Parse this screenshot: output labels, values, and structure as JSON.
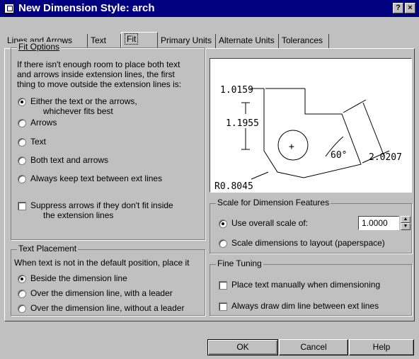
{
  "window": {
    "title": "New Dimension Style: arch",
    "help_btn": "?",
    "close_btn": "×"
  },
  "tabs": [
    {
      "label": "Lines and Arrows"
    },
    {
      "label": "Text"
    },
    {
      "label": "Fit",
      "active": true
    },
    {
      "label": "Primary Units"
    },
    {
      "label": "Alternate Units"
    },
    {
      "label": "Tolerances"
    }
  ],
  "fit_options": {
    "legend": "Fit Options",
    "description": [
      "If there isn't enough room to place both text",
      "and arrows inside extension lines, the first",
      "thing to move outside the extension lines is:"
    ],
    "radios": [
      {
        "label": "Either the text or the arrows,",
        "label2": "whichever fits best",
        "checked": true
      },
      {
        "label": "Arrows",
        "checked": false
      },
      {
        "label": "Text",
        "checked": false
      },
      {
        "label": "Both text and arrows",
        "checked": false
      },
      {
        "label": "Always keep text between ext lines",
        "checked": false
      }
    ],
    "suppress": {
      "label": "Suppress arrows if they don't fit inside",
      "label2": "the extension lines",
      "checked": false
    }
  },
  "text_placement": {
    "legend": "Text Placement",
    "description": "When text is not in the default position, place it",
    "radios": [
      {
        "label": "Beside the dimension line",
        "checked": true
      },
      {
        "label": "Over the dimension line, with a leader",
        "checked": false
      },
      {
        "label": "Over the dimension line, without a leader",
        "checked": false
      }
    ]
  },
  "preview": {
    "dim1": "1.0159",
    "dim2": "1.1955",
    "dim3": "2.0207",
    "angle": "60°",
    "radius": "R0.8045",
    "center": "+"
  },
  "scale": {
    "legend": "Scale for Dimension Features",
    "use_overall": {
      "label": "Use overall scale of:",
      "checked": true,
      "value": "1.0000"
    },
    "to_layout": {
      "label": "Scale dimensions to layout (paperspace)",
      "checked": false
    },
    "spin_up": "▲",
    "spin_down": "▼"
  },
  "fine_tuning": {
    "legend": "Fine Tuning",
    "place_manually": {
      "label": "Place text manually when dimensioning",
      "checked": false
    },
    "always_draw": {
      "label": "Always draw dim line between ext lines",
      "checked": false
    }
  },
  "buttons": {
    "ok": "OK",
    "cancel": "Cancel",
    "help": "Help"
  }
}
